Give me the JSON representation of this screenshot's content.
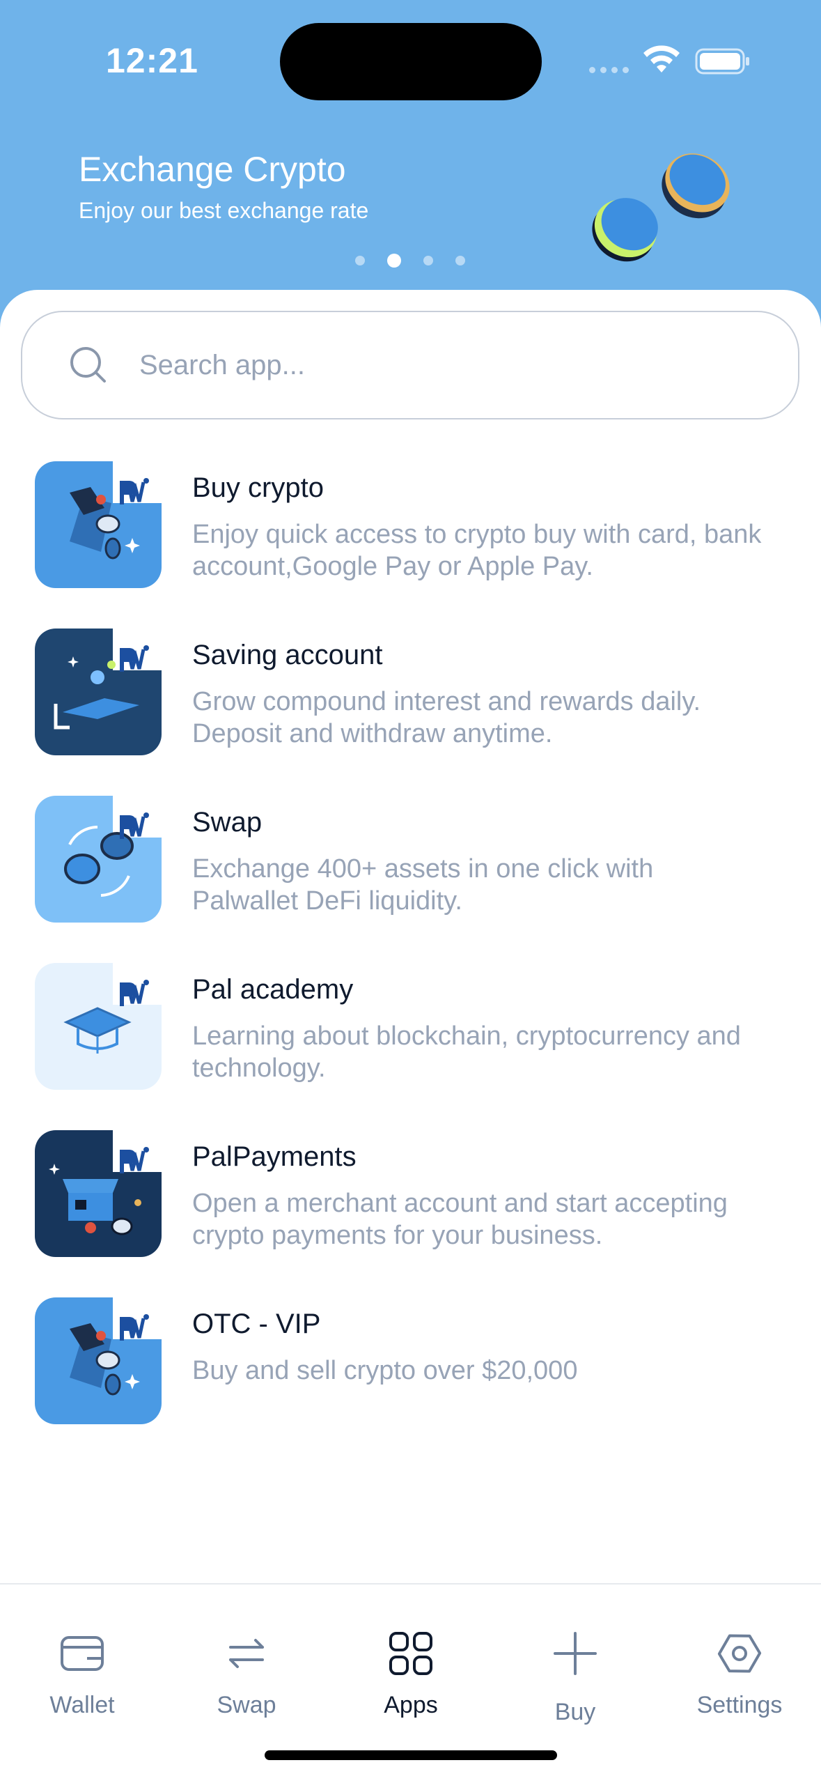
{
  "status_bar": {
    "time": "12:21"
  },
  "banner": {
    "title": "Exchange Crypto",
    "subtitle": "Enjoy our best exchange rate",
    "page_count": 4,
    "active_page": 2
  },
  "search": {
    "placeholder": "Search app..."
  },
  "apps": [
    {
      "title": "Buy crypto",
      "description": "Enjoy quick access to crypto buy with card, bank account,Google Pay or Apple Pay.",
      "icon": "buy-crypto-icon"
    },
    {
      "title": "Saving account",
      "description": "Grow compound interest and rewards daily. Deposit and withdraw anytime.",
      "icon": "saving-account-icon"
    },
    {
      "title": "Swap",
      "description": "Exchange 400+ assets in one click with Palwallet DeFi liquidity.",
      "icon": "swap-app-icon"
    },
    {
      "title": "Pal academy",
      "description": "Learning about blockchain, cryptocurrency and technology.",
      "icon": "pal-academy-icon"
    },
    {
      "title": "PalPayments",
      "description": "Open a merchant account and start accepting crypto payments for your business.",
      "icon": "palpayments-icon"
    },
    {
      "title": "OTC - VIP",
      "description": "Buy and sell crypto over $20,000",
      "icon": "otc-vip-icon"
    }
  ],
  "tabs": [
    {
      "label": "Wallet",
      "icon": "wallet-icon"
    },
    {
      "label": "Swap",
      "icon": "swap-arrows-icon"
    },
    {
      "label": "Apps",
      "icon": "apps-grid-icon",
      "active": true
    },
    {
      "label": "Buy",
      "icon": "plus-icon"
    },
    {
      "label": "Settings",
      "icon": "settings-hexagon-icon"
    }
  ],
  "colors": {
    "header_bg": "#6fb3ea",
    "text_primary": "#0f1a2e",
    "text_secondary": "#97a3b6",
    "tab_inactive": "#6d7f99"
  }
}
